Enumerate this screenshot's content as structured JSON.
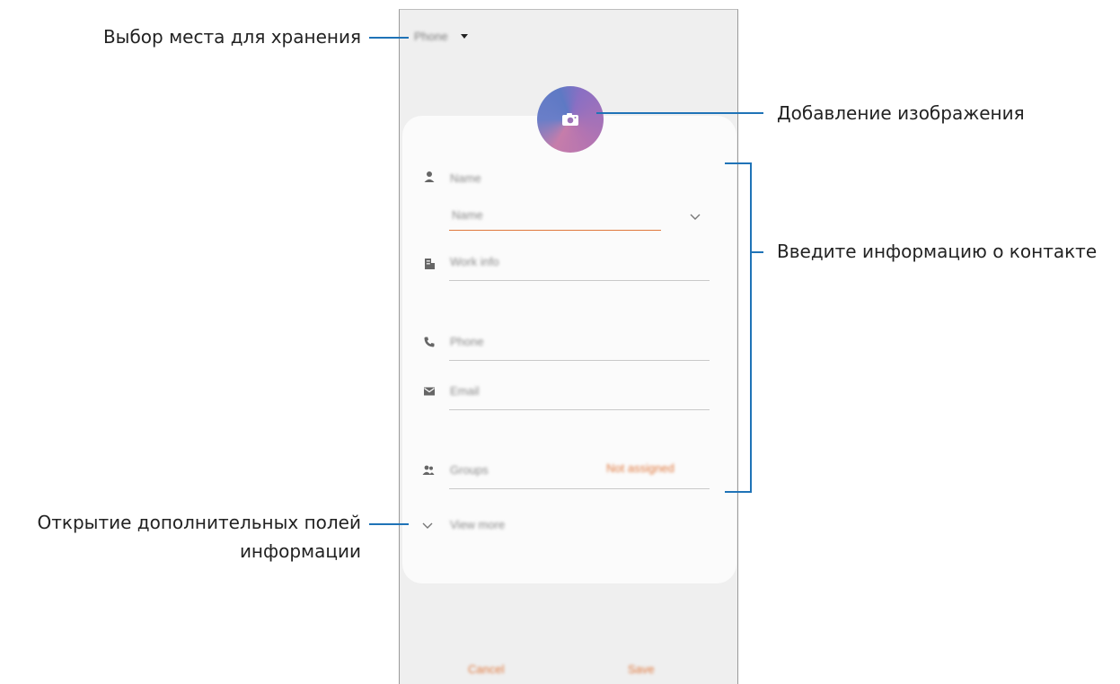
{
  "callouts": {
    "storage": "Выбор места для хранения",
    "image": "Добавление изображения",
    "contact_info": "Введите информацию о контакте",
    "more_fields_line1": "Открытие дополнительных полей",
    "more_fields_line2": "информации"
  },
  "phone": {
    "storage_value": "Phone",
    "name_label": "Name",
    "name_sub": "Name",
    "company": "Work info",
    "phone_label": "Phone",
    "email_label": "Email",
    "groups_label": "Groups",
    "groups_value": "Not assigned",
    "view_more": "View more",
    "cancel": "Cancel",
    "save": "Save"
  },
  "colors": {
    "accent": "#1f73b7",
    "orange": "#e0783d"
  }
}
